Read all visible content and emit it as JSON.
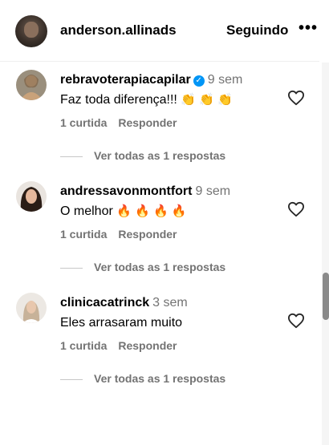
{
  "header": {
    "username": "anderson.allinads",
    "follow_label": "Seguindo",
    "more_label": "•••"
  },
  "comments": [
    {
      "username": "rebravoterapiacapilar",
      "verified": true,
      "time": "9 sem",
      "text": "Faz toda diferença!!!",
      "emojis": "👏 👏 👏",
      "likes": "1 curtida",
      "reply_label": "Responder",
      "replies_label": "Ver todas as 1 respostas"
    },
    {
      "username": "andressavonmontfort",
      "verified": false,
      "time": "9 sem",
      "text": "O melhor",
      "emojis": "🔥 🔥 🔥 🔥",
      "likes": "1 curtida",
      "reply_label": "Responder",
      "replies_label": "Ver todas as 1 respostas"
    },
    {
      "username": "clinicacatrinck",
      "verified": false,
      "time": "3 sem",
      "text": "Eles arrasaram muito",
      "emojis": "",
      "likes": "1 curtida",
      "reply_label": "Responder",
      "replies_label": "Ver todas as 1 respostas"
    }
  ],
  "colors": {
    "verified": "#0095f6",
    "muted": "#737373",
    "divider": "#efefef",
    "emoji_clap": "#f5b400",
    "emoji_fire": "#e8501a"
  }
}
